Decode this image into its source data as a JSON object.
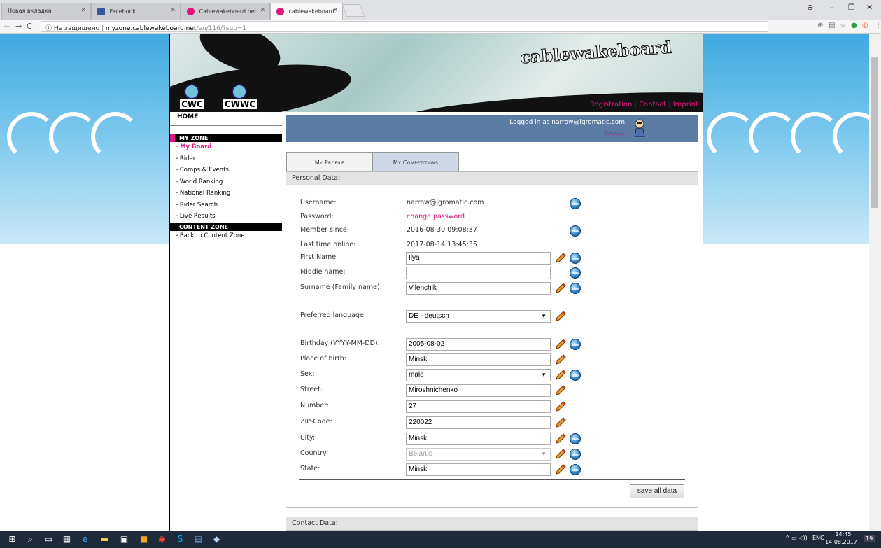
{
  "browser": {
    "tabs": [
      {
        "title": "Новая вкладка",
        "active": false
      },
      {
        "title": "Facebook",
        "active": false
      },
      {
        "title": "Cablewakeboard.net",
        "active": false
      },
      {
        "title": "cablewakeboard",
        "active": true
      }
    ],
    "security": "Не защищено",
    "url_host": "myzone.cablewakeboard.net",
    "url_path": "/en/116/?sub=1",
    "window": {
      "account": "⊖",
      "minimize": "–",
      "restore": "❐",
      "close": "✕"
    }
  },
  "site": {
    "logo_text": "cablewakeboard",
    "logo_small": "CWC",
    "logo_small2": "CWWC",
    "top_links": [
      "Registration",
      "Contact",
      "Imprint"
    ]
  },
  "sidebar": {
    "home": "HOME",
    "my_zone": "MY ZONE",
    "my_zone_items": [
      "My Board",
      "Rider",
      "Comps & Events",
      "World Ranking",
      "National Ranking",
      "Rider Search",
      "Live Results"
    ],
    "content_zone": "CONTENT ZONE",
    "content_zone_items": [
      "Back to Content Zone"
    ]
  },
  "login": {
    "text": "Logged in as narrow@igromatic.com",
    "logout": "logout"
  },
  "profile_tabs": [
    "My Profile",
    "My Competitions"
  ],
  "personal": {
    "header": "Personal Data:",
    "username_label": "Username:",
    "username": "narrow@igromatic.com",
    "password_label": "Password:",
    "password_link": "change password",
    "member_since_label": "Member since:",
    "member_since": "2016-08-30 09:08:37",
    "last_online_label": "Last time online:",
    "last_online": "2017-08-14 13:45:35",
    "first_name_label": "First Name:",
    "first_name": "Ilya",
    "middle_name_label": "Middle name:",
    "middle_name": "",
    "surname_label": "Surname (Family name):",
    "surname": "Vilenchik",
    "language_label": "Preferred language:",
    "language": "DE - deutsch",
    "birthday_label": "Birthday (YYYY-MM-DD):",
    "birthday": "2005-08-02",
    "place_of_birth_label": "Place of birth:",
    "place_of_birth": "Minsk",
    "sex_label": "Sex:",
    "sex": "male",
    "street_label": "Street:",
    "street": "Miroshnichenko",
    "number_label": "Number:",
    "number": "27",
    "zip_label": "ZIP-Code:",
    "zip": "220022",
    "city_label": "City:",
    "city": "Minsk",
    "country_label": "Country:",
    "country": "Belarus",
    "state_label": "State:",
    "state": "Minsk",
    "save_label": "save all data"
  },
  "contact": {
    "header": "Contact Data:"
  },
  "taskbar": {
    "lang": "ENG",
    "time": "14:45",
    "date": "14.08.2017",
    "notif": "19"
  },
  "colors": {
    "accent": "#e0167e",
    "login_bar": "#5c7ca6",
    "sky": "#55b4e4"
  }
}
